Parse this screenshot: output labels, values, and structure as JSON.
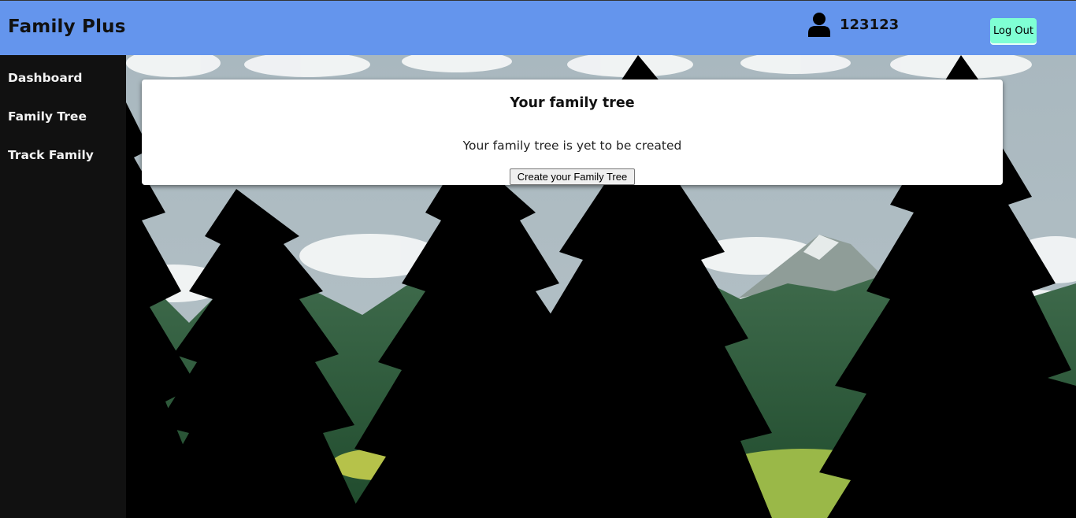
{
  "header": {
    "brand": "Family Plus",
    "username": "123123",
    "logout_label": "Log Out"
  },
  "sidebar": {
    "items": [
      {
        "label": "Dashboard"
      },
      {
        "label": "Family Tree"
      },
      {
        "label": "Track Family"
      }
    ]
  },
  "main": {
    "title": "Your family tree",
    "message": "Your family tree is yet to be created",
    "create_button_label": "Create your Family Tree"
  },
  "colors": {
    "header_bg": "#6495ed",
    "sidebar_bg": "#111111",
    "logout_bg": "#7fffd4"
  },
  "icons": {
    "user": "user-icon"
  }
}
